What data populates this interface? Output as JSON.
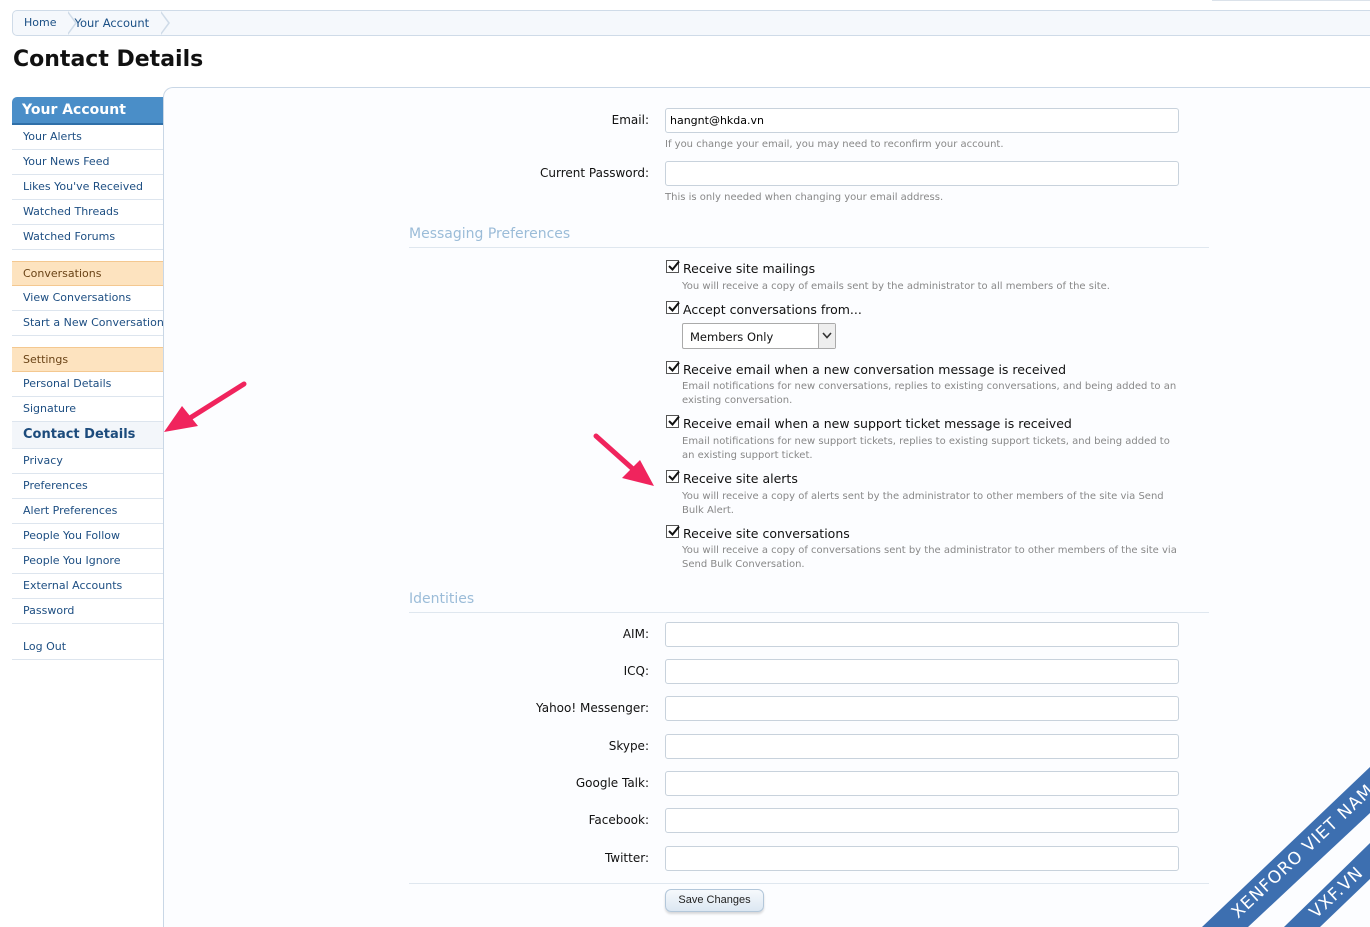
{
  "breadcrumb": [
    "Home",
    "Your Account"
  ],
  "page_title": "Contact Details",
  "sidebar": {
    "heading": "Your Account",
    "group1": [
      "Your Alerts",
      "Your News Feed",
      "Likes You've Received",
      "Watched Threads",
      "Watched Forums"
    ],
    "conversations_heading": "Conversations",
    "group2": [
      "View Conversations",
      "Start a New Conversation"
    ],
    "settings_heading": "Settings",
    "group3": [
      "Personal Details",
      "Signature",
      "Contact Details",
      "Privacy",
      "Preferences",
      "Alert Preferences",
      "People You Follow",
      "People You Ignore",
      "External Accounts",
      "Password"
    ],
    "logout": "Log Out",
    "active_item": "Contact Details"
  },
  "form": {
    "email_label": "Email:",
    "email_value": "hangnt@hkda.vn",
    "email_hint": "If you change your email, you may need to reconfirm your account.",
    "password_label": "Current Password:",
    "password_value": "",
    "password_hint": "This is only needed when changing your email address.",
    "messaging_heading": "Messaging Preferences",
    "options": [
      {
        "label": "Receive site mailings",
        "hint": "You will receive a copy of emails sent by the administrator to all members of the site.",
        "checked": true
      },
      {
        "label": "Accept conversations from...",
        "hint": "",
        "checked": true
      },
      {
        "label": "Receive email when a new conversation message is received",
        "hint": "Email notifications for new conversations, replies to existing conversations, and being added to an existing conversation.",
        "checked": true
      },
      {
        "label": "Receive email when a new support ticket message is received",
        "hint": "Email notifications for new support tickets, replies to existing support tickets, and being added to an existing support ticket.",
        "checked": true
      },
      {
        "label": "Receive site alerts",
        "hint": "You will receive a copy of alerts sent by the administrator to other members of the site via Send Bulk Alert.",
        "checked": true
      },
      {
        "label": "Receive site conversations",
        "hint": "You will receive a copy of conversations sent by the administrator to other members of the site via Send Bulk Conversation.",
        "checked": true
      }
    ],
    "conversation_select_value": "Members Only",
    "identities_heading": "Identities",
    "identities": [
      {
        "label": "AIM:",
        "value": ""
      },
      {
        "label": "ICQ:",
        "value": ""
      },
      {
        "label": "Yahoo! Messenger:",
        "value": ""
      },
      {
        "label": "Skype:",
        "value": ""
      },
      {
        "label": "Google Talk:",
        "value": ""
      },
      {
        "label": "Facebook:",
        "value": ""
      },
      {
        "label": "Twitter:",
        "value": ""
      }
    ],
    "save_label": "Save Changes"
  },
  "watermark": {
    "line1": "XENFORO VIET NAM",
    "line2": "VXF.VN"
  },
  "colors": {
    "accent": "#4a8ec8",
    "group_bg": "#fde3bf",
    "arrow": "#f0245d",
    "watermark": "#3d6fb0"
  }
}
